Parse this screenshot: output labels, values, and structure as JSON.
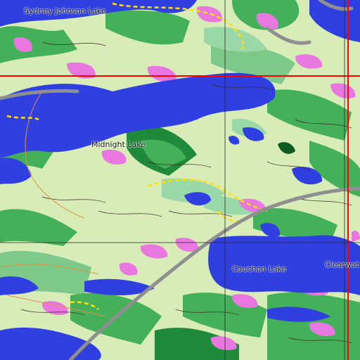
{
  "map": {
    "labels": {
      "sydney_johnson_lake": "Sydney Johnson Lake",
      "midnight_lake": "Midnight Lake",
      "cauchon_lake": "Cauchon Lake",
      "clearwater": "Clearwat"
    },
    "colors": {
      "land": "#d8ecb8",
      "water": "#2f3fe0",
      "forest_dark": "#1f8a3a",
      "forest_mid": "#45b05a",
      "wetland": "#9ad8a8",
      "clearing": "#e878e0",
      "road": "#8f8f8f",
      "grid_line": "#ff0000",
      "trail": "#ffe000"
    }
  }
}
